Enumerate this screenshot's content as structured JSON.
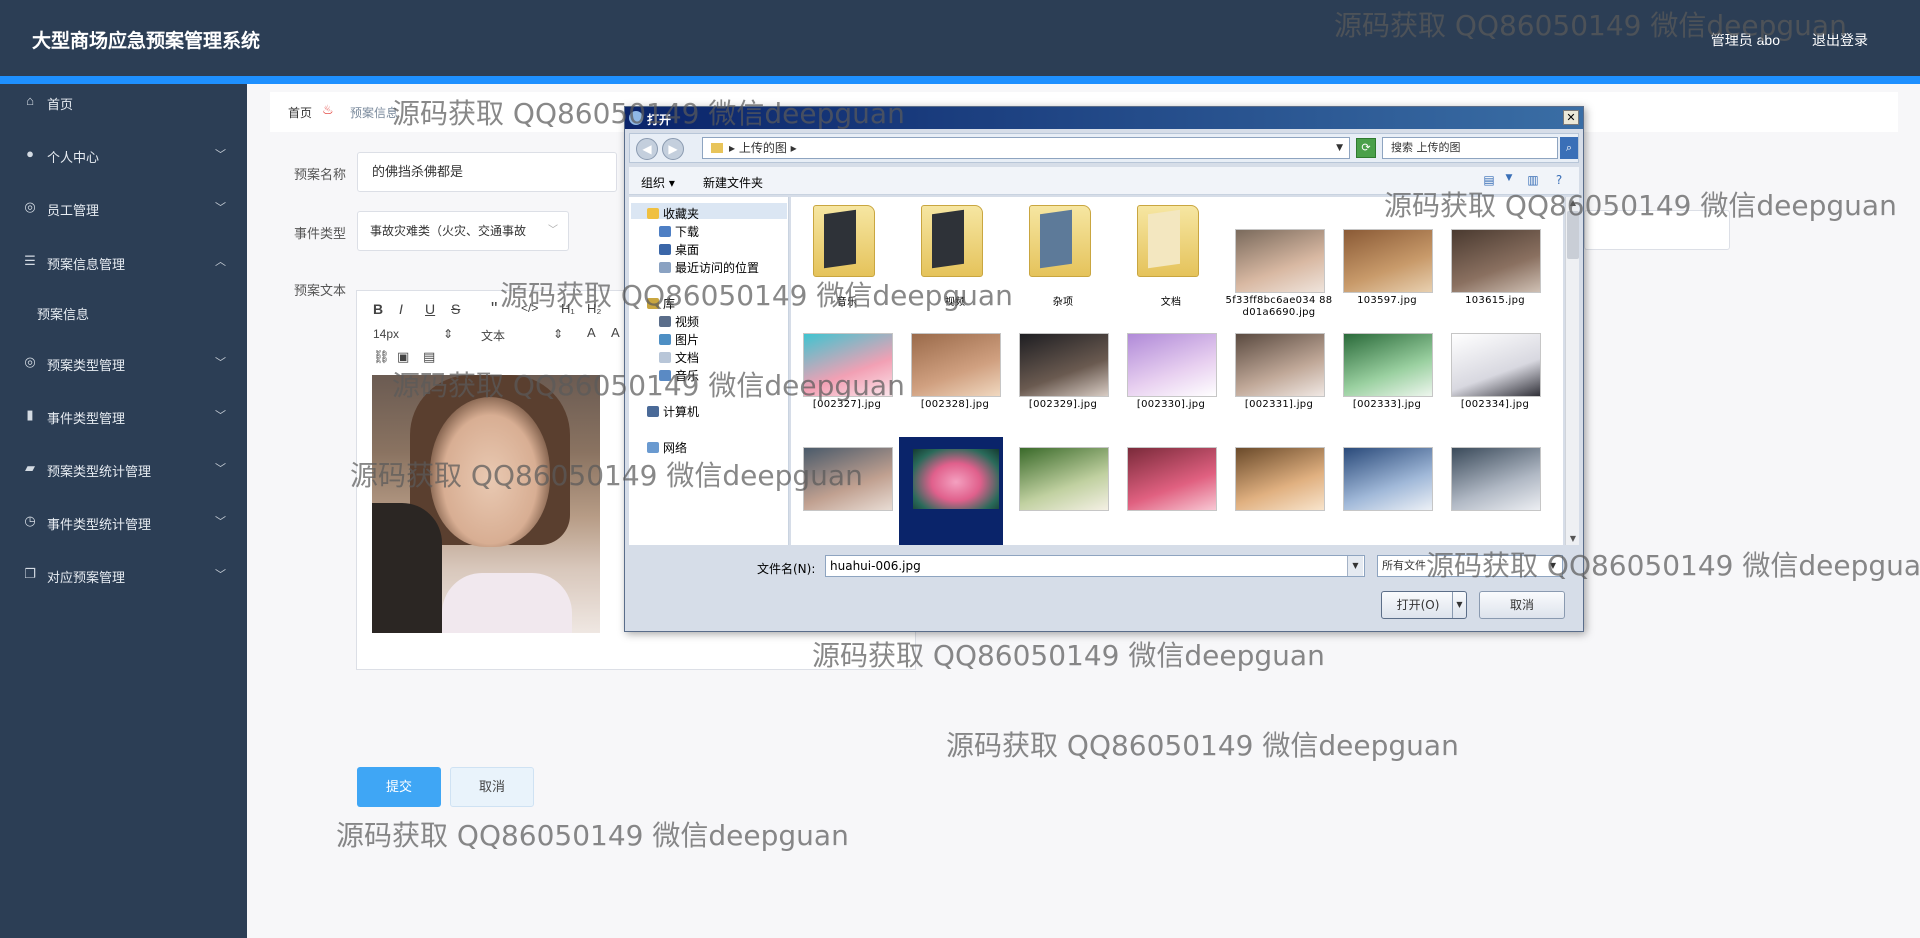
{
  "header": {
    "app_title": "大型商场应急预案管理系统",
    "user": "管理员 abo",
    "logout": "退出登录"
  },
  "sidebar": {
    "items": [
      {
        "label": "首页",
        "icon": "home-icon"
      },
      {
        "label": "个人中心",
        "icon": "user-icon"
      },
      {
        "label": "员工管理",
        "icon": "globe-icon"
      },
      {
        "label": "预案信息管理",
        "icon": "list-icon"
      },
      {
        "label": "预案类型管理",
        "icon": "globe-icon"
      },
      {
        "label": "事件类型管理",
        "icon": "chart-icon"
      },
      {
        "label": "预案类型统计管理",
        "icon": "chat-icon"
      },
      {
        "label": "事件类型统计管理",
        "icon": "clock-icon"
      },
      {
        "label": "对应预案管理",
        "icon": "copy-icon"
      }
    ],
    "sub_item": "预案信息"
  },
  "breadcrumb": {
    "home": "首页",
    "current": "预案信息"
  },
  "form": {
    "name_label": "预案名称",
    "name_value": "的佛挡杀佛都是",
    "event_label": "事件类型",
    "event_value": "事故灾难类（火灾、交通事故",
    "text_label": "预案文本",
    "font_size": "14px",
    "font_style": "文本",
    "submit": "提交",
    "cancel": "取消"
  },
  "dialog": {
    "title": "打开",
    "path": "上传的图",
    "search_placeholder": "搜索 上传的图",
    "organize": "组织",
    "new_folder": "新建文件夹",
    "tree": [
      "收藏夹",
      "下载",
      "桌面",
      "最近访问的位置",
      "库",
      "视频",
      "图片",
      "文档",
      "音乐",
      "计算机",
      "网络"
    ],
    "folders": [
      "音乐",
      "视频",
      "杂项",
      "文档"
    ],
    "files_row1": [
      "5f33ff8bc6ae034 88d01a6690.jpg",
      "103597.jpg",
      "103615.jpg"
    ],
    "files_row2": [
      "[002327].jpg",
      "[002328].jpg",
      "[002329].jpg",
      "[002330].jpg",
      "[002331].jpg",
      "[002333].jpg",
      "[002334].jpg"
    ],
    "filename_label": "文件名(N):",
    "filename_value": "huahui-006.jpg",
    "filetype": "所有文件",
    "open_btn": "打开(O)",
    "cancel_btn": "取消"
  },
  "watermark": "源码获取 QQ86050149 微信deepguan"
}
